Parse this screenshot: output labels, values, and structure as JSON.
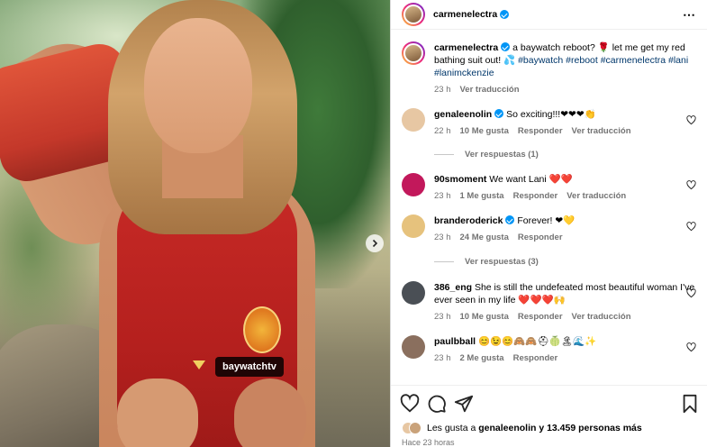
{
  "post": {
    "username": "carmenelectra",
    "caption_text": "a baywatch reboot? 🌹 let me get my red bathing suit out! 💦",
    "caption_tags": "#baywatch #reboot #carmenelectra #lani #lanimckenzie",
    "age": "23 h",
    "translate": "Ver traducción",
    "photo_tag": "baywatchtv"
  },
  "comments": [
    {
      "user": "genaleenolin",
      "verified": true,
      "text": "So exciting!!!❤❤❤👏",
      "age": "22 h",
      "likes": "10 Me gusta",
      "reply": "Responder",
      "translate": "Ver traducción",
      "avatar_color": "#e7c7a3"
    },
    {
      "user": "90smoment",
      "verified": false,
      "text": "We want Lani ❤️❤️",
      "age": "23 h",
      "likes": "1 Me gusta",
      "reply": "Responder",
      "translate": "Ver traducción",
      "avatar_color": "#c2185b"
    },
    {
      "user": "branderoderick",
      "verified": true,
      "text": "Forever! ❤💛",
      "age": "23 h",
      "likes": "24 Me gusta",
      "reply": "Responder",
      "translate": "",
      "avatar_color": "#e6c27d"
    },
    {
      "user": "386_eng",
      "verified": false,
      "text": "She is still the undefeated most beautiful woman I've ever seen in my life ❤️❤️❤️🙌",
      "age": "23 h",
      "likes": "10 Me gusta",
      "reply": "Responder",
      "translate": "Ver traducción",
      "avatar_color": "#4a4f55"
    },
    {
      "user": "paulbball",
      "verified": false,
      "text": "😊😉😊🙈🙈⛑🍈🏝🌊✨",
      "age": "23 h",
      "likes": "2 Me gusta",
      "reply": "Responder",
      "translate": "",
      "avatar_color": "#8a6f5e"
    }
  ],
  "replies": {
    "first": "Ver respuestas (1)",
    "second": "Ver respuestas (3)"
  },
  "footer": {
    "likes_prefix": "Les gusta a ",
    "likes_user": "genaleenolin",
    "likes_suffix": " y 13.459 personas más",
    "time": "Hace 23 horas"
  },
  "icons": {
    "more": "⋯",
    "like": "heart-icon",
    "comment": "comment-icon",
    "share": "share-icon",
    "save": "bookmark-icon",
    "next": "chevron-right-icon"
  },
  "colors": {
    "verified": "#0095f6",
    "hashtag": "#00376b",
    "meta": "#737373",
    "heart_red": "#ed4956"
  }
}
